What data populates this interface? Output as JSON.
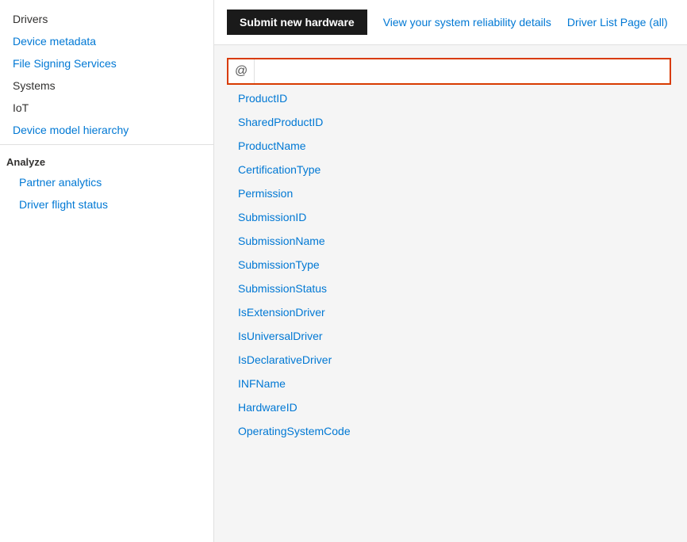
{
  "sidebar": {
    "items": [
      {
        "label": "Drivers",
        "type": "plain",
        "id": "drivers"
      },
      {
        "label": "Device metadata",
        "type": "link",
        "id": "device-metadata"
      },
      {
        "label": "File Signing Services",
        "type": "link",
        "id": "file-signing-services"
      },
      {
        "label": "Systems",
        "type": "plain",
        "id": "systems"
      },
      {
        "label": "IoT",
        "type": "plain",
        "id": "iot"
      },
      {
        "label": "Device model hierarchy",
        "type": "link",
        "id": "device-model-hierarchy"
      }
    ],
    "analyze_section": "Analyze",
    "analyze_items": [
      {
        "label": "Partner analytics",
        "id": "partner-analytics"
      },
      {
        "label": "Driver flight status",
        "id": "driver-flight-status"
      }
    ]
  },
  "toolbar": {
    "submit_label": "Submit new hardware",
    "reliability_label": "View your system reliability details",
    "driver_list_label": "Driver List Page (all)"
  },
  "search": {
    "icon": "@",
    "placeholder": ""
  },
  "fields": [
    "ProductID",
    "SharedProductID",
    "ProductName",
    "CertificationType",
    "Permission",
    "SubmissionID",
    "SubmissionName",
    "SubmissionType",
    "SubmissionStatus",
    "IsExtensionDriver",
    "IsUniversalDriver",
    "IsDeclarativeDriver",
    "INFName",
    "HardwareID",
    "OperatingSystemCode"
  ]
}
